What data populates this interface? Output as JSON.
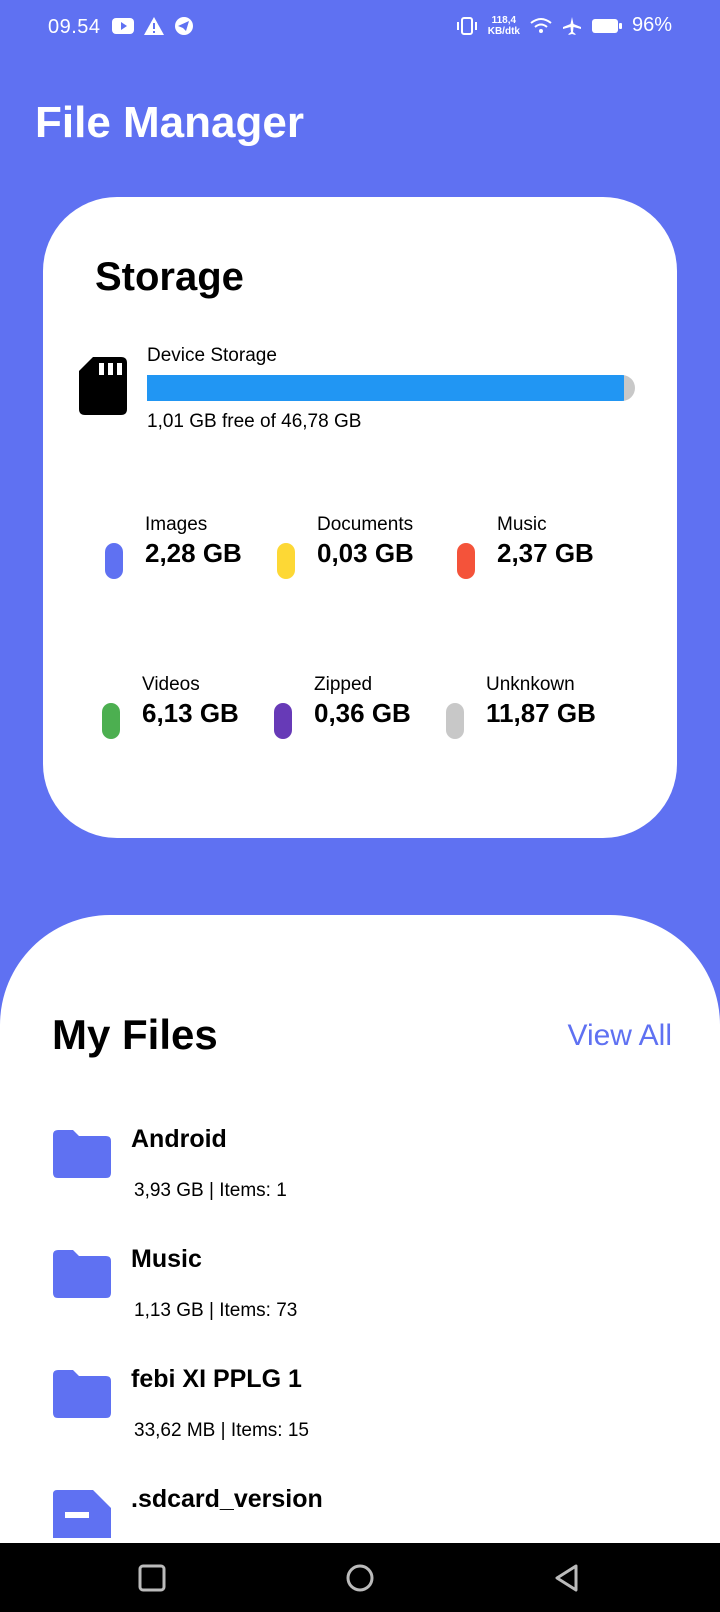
{
  "status_bar": {
    "time": "09.54",
    "net_speed_value": "118,4",
    "net_speed_unit": "KB/dtk",
    "battery": "96%",
    "icons": [
      "youtube-icon",
      "warning-icon",
      "telegram-icon",
      "vibrate-icon",
      "wifi-icon",
      "airplane-icon",
      "battery-icon"
    ]
  },
  "app": {
    "title": "File Manager"
  },
  "storage": {
    "title": "Storage",
    "device_label": "Device Storage",
    "free_text": "1,01 GB free of 46,78 GB",
    "used_fraction": 0.978,
    "categories": [
      {
        "name": "Images",
        "size": "2,28 GB",
        "color": "#5F71F2"
      },
      {
        "name": "Documents",
        "size": "0,03 GB",
        "color": "#FDD835"
      },
      {
        "name": "Music",
        "size": "2,37 GB",
        "color": "#F4533A"
      },
      {
        "name": "Videos",
        "size": "6,13 GB",
        "color": "#4CAF50"
      },
      {
        "name": "Zipped",
        "size": "0,36 GB",
        "color": "#673AB7"
      },
      {
        "name": "Unknkown",
        "size": "11,87 GB",
        "color": "#C8C8C8"
      }
    ]
  },
  "my_files": {
    "title": "My Files",
    "view_all": "View All",
    "items": [
      {
        "name": "Android",
        "meta": "3,93 GB | Items: 1",
        "icon": "folder-icon"
      },
      {
        "name": "Music",
        "meta": "1,13 GB | Items: 73",
        "icon": "folder-icon"
      },
      {
        "name": "febi XI PPLG 1",
        "meta": "33,62 MB | Items: 15",
        "icon": "folder-icon"
      },
      {
        "name": ".sdcard_version",
        "meta": "",
        "icon": "file-icon"
      }
    ]
  },
  "colors": {
    "primary": "#5F71F2",
    "storage_fill": "#2196F3"
  }
}
